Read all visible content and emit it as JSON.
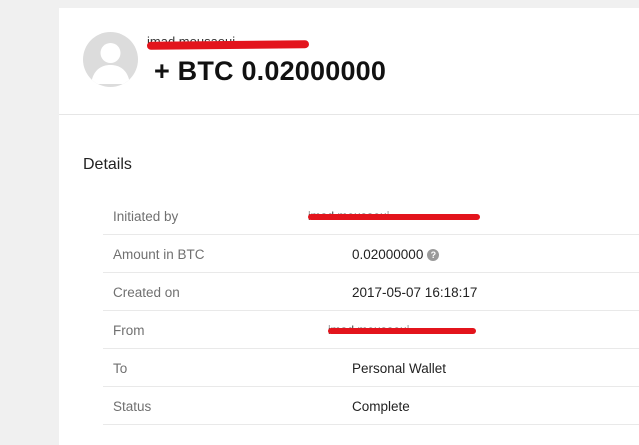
{
  "transaction": {
    "sender_name": "imad mousaoui",
    "amount_display": "+ BTC 0.02000000"
  },
  "details": {
    "title": "Details",
    "rows": [
      {
        "label": "Initiated by",
        "value": "imad mousaoui"
      },
      {
        "label": "Amount in BTC",
        "value": "0.02000000",
        "info_icon": "info-icon"
      },
      {
        "label": "Created on",
        "value": "2017-05-07 16:18:17"
      },
      {
        "label": "From",
        "value": "imad mousaoui"
      },
      {
        "label": "To",
        "value": "Personal Wallet"
      },
      {
        "label": "Status",
        "value": "Complete"
      }
    ]
  },
  "colors": {
    "redaction": "#e3141c",
    "background": "#f0f0f0",
    "panel": "#ffffff"
  }
}
